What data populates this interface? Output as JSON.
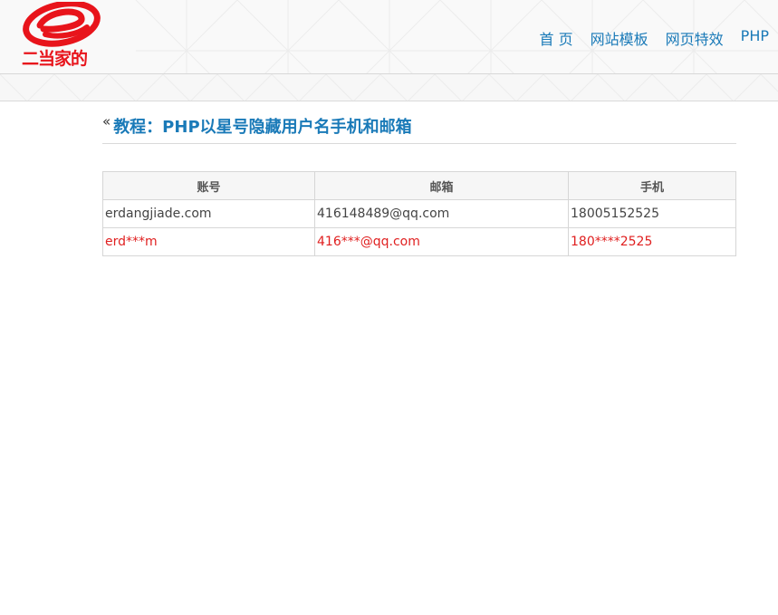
{
  "brand": {
    "logo_text": "二当家的",
    "logo_color": "#e8141b"
  },
  "nav": {
    "items": [
      {
        "label": "首 页"
      },
      {
        "label": "网站模板"
      },
      {
        "label": "网页特效"
      },
      {
        "label": "PHP"
      }
    ],
    "color": "#1a7ab8"
  },
  "page": {
    "back_glyph": "«",
    "title": "教程：PHP以星号隐藏用户名手机和邮箱"
  },
  "table": {
    "headers": [
      "账号",
      "邮箱",
      "手机"
    ],
    "rows": [
      {
        "account": "erdangjiade.com",
        "email": "416148489@qq.com",
        "phone": "18005152525"
      },
      {
        "account": "erd***m",
        "email": "416***@qq.com",
        "phone": "180****2525"
      }
    ],
    "masked_color": "#e02020"
  }
}
